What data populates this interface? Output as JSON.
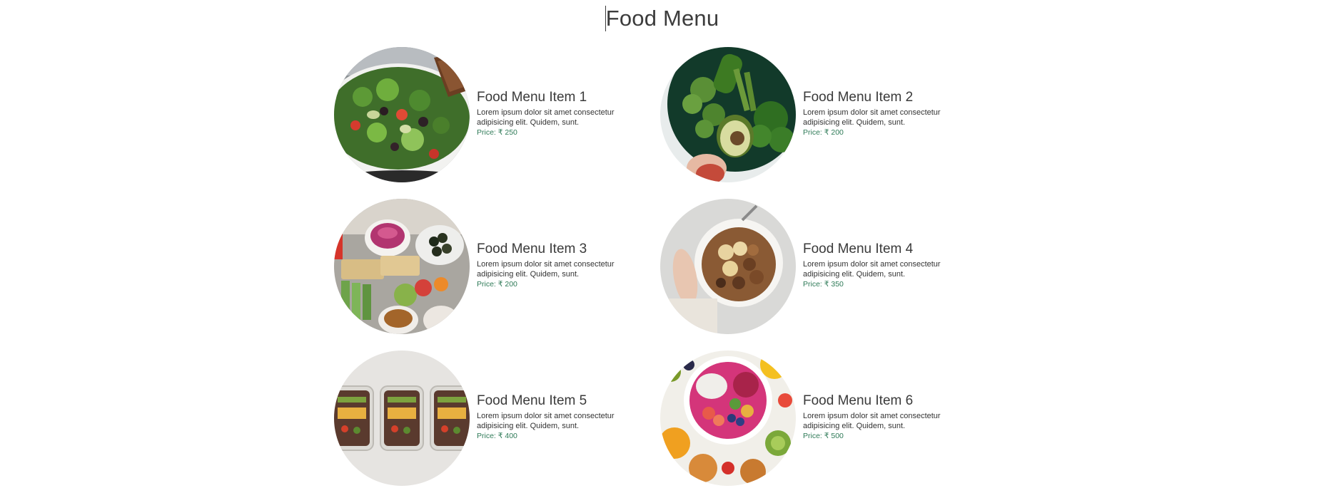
{
  "page": {
    "title": "Food Menu"
  },
  "menu": {
    "items": [
      {
        "name": "Food Menu Item 1",
        "description": "Lorem ipsum dolor sit amet consectetur adipisicing elit. Quidem, sunt.",
        "price": "Price: ₹ 250"
      },
      {
        "name": "Food Menu Item 2",
        "description": "Lorem ipsum dolor sit amet consectetur adipisicing elit. Quidem, sunt.",
        "price": "Price: ₹ 200"
      },
      {
        "name": "Food Menu Item 3",
        "description": "Lorem ipsum dolor sit amet consectetur adipisicing elit. Quidem, sunt.",
        "price": "Price: ₹ 200"
      },
      {
        "name": "Food Menu Item 4",
        "description": "Lorem ipsum dolor sit amet consectetur adipisicing elit. Quidem, sunt.",
        "price": "Price: ₹ 350"
      },
      {
        "name": "Food Menu Item 5",
        "description": "Lorem ipsum dolor sit amet consectetur adipisicing elit. Quidem, sunt.",
        "price": "Price: ₹ 400"
      },
      {
        "name": "Food Menu Item 6",
        "description": "Lorem ipsum dolor sit amet consectetur adipisicing elit. Quidem, sunt.",
        "price": "Price: ₹ 500"
      }
    ]
  },
  "colors": {
    "price_accent": "#2e7a57",
    "heading_text": "#3c3c3c"
  }
}
